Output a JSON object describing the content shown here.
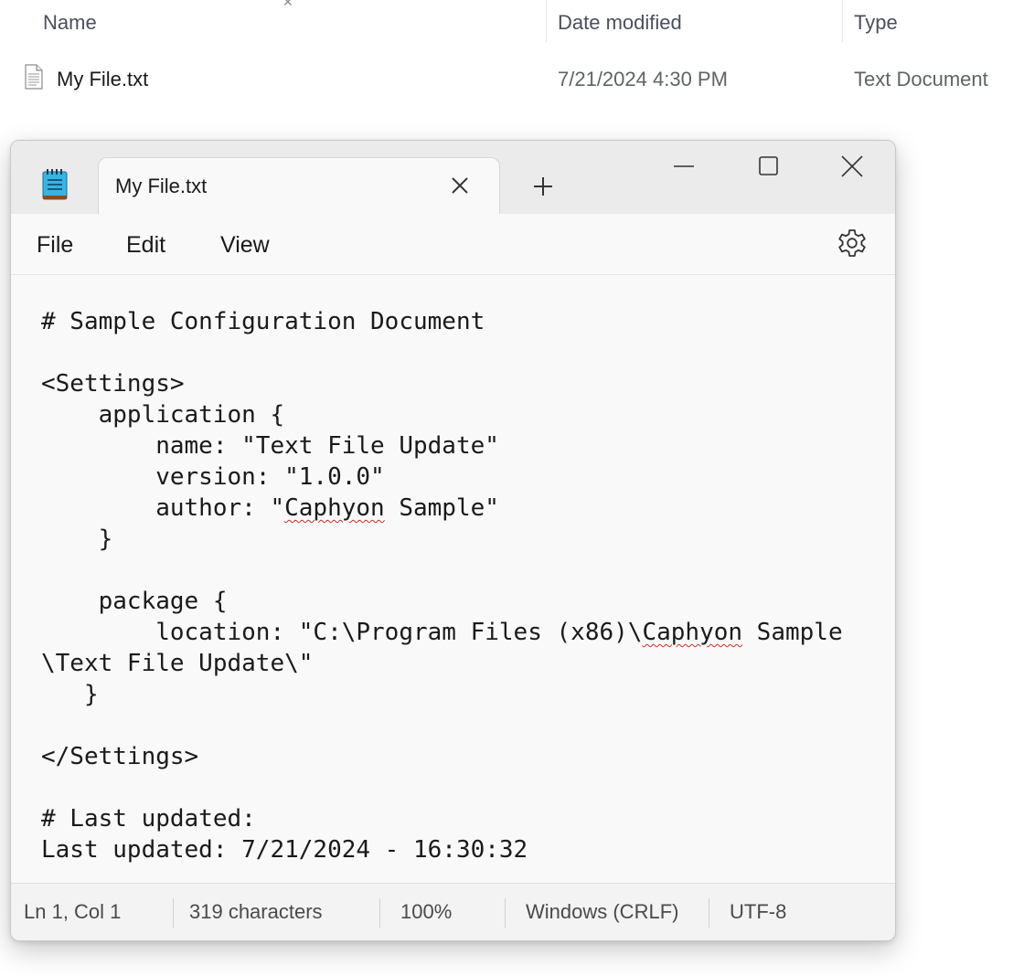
{
  "explorer": {
    "columns": {
      "name": "Name",
      "date_modified": "Date modified",
      "type": "Type"
    },
    "file": {
      "icon": "text-file-icon",
      "name": "My File.txt",
      "date": "7/21/2024 4:30 PM",
      "type": "Text Document"
    }
  },
  "notepad": {
    "app_icon": "notepad-icon",
    "tab_title": "My File.txt",
    "menu": {
      "file": "File",
      "edit": "Edit",
      "view": "View"
    },
    "content_lines": {
      "l1": "# Sample Configuration Document",
      "l3": "<Settings>",
      "l4": "    application {",
      "l5": "        name: \"Text File Update\"",
      "l6": "        version: \"1.0.0\"",
      "l7a": "        author: \"",
      "l7b": "Caphyon",
      "l7c": " Sample\"",
      "l8": "    }",
      "l10": "    package {",
      "l11a": "        location: \"C:\\Program Files (x86)\\",
      "l11b": "Caphyon",
      "l11c": " Sample",
      "l12": "\\Text File Update\\\"",
      "l13": "   }",
      "l15": "</Settings>",
      "l17": "# Last updated:",
      "l18": "Last updated: 7/21/2024 - 16:30:32"
    },
    "status": {
      "position": "Ln 1, Col 1",
      "characters": "319 characters",
      "zoom": "100%",
      "line_ending": "Windows (CRLF)",
      "encoding": "UTF-8"
    },
    "colors": {
      "spellcheck": "#d12b2b",
      "titlebar": "#ebebeb",
      "editor_bg": "#f9f9f9"
    }
  }
}
